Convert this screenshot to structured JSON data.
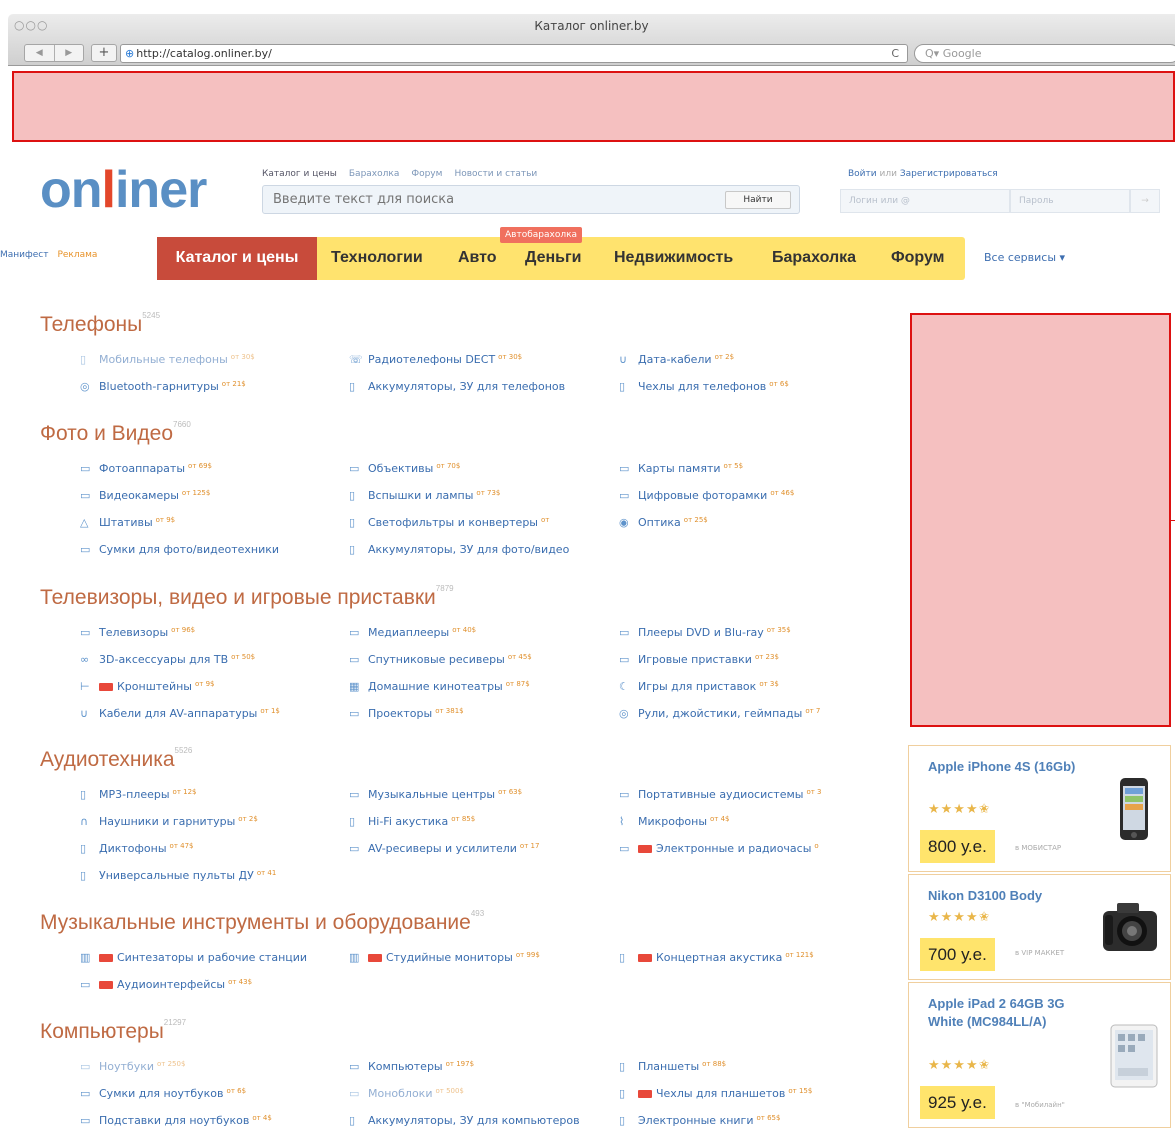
{
  "browser": {
    "window_title": "Каталог onliner.by",
    "url": "http://catalog.onliner.by/",
    "search_placeholder": "Google",
    "traffic": "○○○",
    "back": "◀",
    "forward": "▶",
    "plus": "+",
    "globe": "⊕",
    "reload": "C",
    "search_prefix": "Q▾"
  },
  "header": {
    "logo_a": "on",
    "logo_b": "l",
    "logo_c": "iner",
    "top_links": [
      "Каталог и цены",
      "Барахолка",
      "Форум",
      "Новости и статьи"
    ],
    "search_placeholder": "Введите текст для поиска",
    "find_label": "Найти",
    "login_link": "Войти",
    "or_text": "или",
    "register_link": "Зарегистрироваться",
    "login_placeholder": "Логин или @",
    "password_placeholder": "Пароль",
    "login_button": "→"
  },
  "nav": {
    "left_links": [
      "Манифест",
      "Реклама"
    ],
    "active": "Каталог и цены",
    "items": [
      "Технологии",
      "Авто",
      "Деньги",
      "Недвижимость",
      "Барахолка",
      "Форум"
    ],
    "badge": "Автобарахолка",
    "all_services": "Все сервисы ▾"
  },
  "catalog": [
    {
      "title": "Телефоны",
      "count": "5245",
      "items": [
        {
          "icon": "▯",
          "label": "Мобильные телефоны",
          "price": "от 30$"
        },
        {
          "icon": "☏",
          "label": "Радиотелефоны DECT",
          "price": "от 30$"
        },
        {
          "icon": "∪",
          "label": "Дата-кабели",
          "price": "от 2$"
        },
        {
          "icon": "◎",
          "label": "Bluetooth-гарнитуры",
          "price": "от 21$"
        },
        {
          "icon": "▯",
          "label": "Аккумуляторы, ЗУ для телефонов",
          "price": ""
        },
        {
          "icon": "▯",
          "label": "Чехлы для телефонов",
          "price": "от 6$"
        }
      ]
    },
    {
      "title": "Фото и Видео",
      "count": "7660",
      "items": [
        {
          "icon": "▭",
          "label": "Фотоаппараты",
          "price": "от 69$"
        },
        {
          "icon": "▭",
          "label": "Объективы",
          "price": "от 70$"
        },
        {
          "icon": "▭",
          "label": "Карты памяти",
          "price": "от 5$"
        },
        {
          "icon": "▭",
          "label": "Видеокамеры",
          "price": "от 125$"
        },
        {
          "icon": "▯",
          "label": "Вспышки и лампы",
          "price": "от 73$"
        },
        {
          "icon": "▭",
          "label": "Цифровые фоторамки",
          "price": "от 46$"
        },
        {
          "icon": "△",
          "label": "Штативы",
          "price": "от 9$"
        },
        {
          "icon": "▯",
          "label": "Светофильтры и конвертеры",
          "price": "от"
        },
        {
          "icon": "◉",
          "label": "Оптика",
          "price": "от 25$"
        },
        {
          "icon": "▭",
          "label": "Сумки для фото/видеотехники",
          "price": ""
        },
        {
          "icon": "▯",
          "label": "Аккумуляторы, ЗУ для фото/видео",
          "price": ""
        }
      ]
    },
    {
      "title": "Телевизоры, видео и игровые приставки",
      "count": "7879",
      "items": [
        {
          "icon": "▭",
          "label": "Телевизоры",
          "price": "от 96$"
        },
        {
          "icon": "▭",
          "label": "Медиаплееры",
          "price": "от 40$"
        },
        {
          "icon": "▭",
          "label": "Плееры DVD и Blu-ray",
          "price": "от 35$"
        },
        {
          "icon": "∞",
          "label": "3D-аксессуары для ТВ",
          "price": "от 50$"
        },
        {
          "icon": "▭",
          "label": "Спутниковые ресиверы",
          "price": "от 45$"
        },
        {
          "icon": "▭",
          "label": "Игровые приставки",
          "price": "от 23$"
        },
        {
          "icon": "⊢",
          "label": "Кронштейны",
          "price": "от 9$",
          "new": true
        },
        {
          "icon": "▦",
          "label": "Домашние кинотеатры",
          "price": "от 87$"
        },
        {
          "icon": "☾",
          "label": "Игры для приставок",
          "price": "от 3$"
        },
        {
          "icon": "∪",
          "label": "Кабели для AV-аппаратуры",
          "price": "от 1$"
        },
        {
          "icon": "▭",
          "label": "Проекторы",
          "price": "от 381$"
        },
        {
          "icon": "◎",
          "label": "Рули, джойстики, геймпады",
          "price": "от 7"
        }
      ]
    },
    {
      "title": "Аудиотехника",
      "count": "5526",
      "items": [
        {
          "icon": "▯",
          "label": "МР3-плееры",
          "price": "от 12$"
        },
        {
          "icon": "▭",
          "label": "Музыкальные центры",
          "price": "от 63$"
        },
        {
          "icon": "▭",
          "label": "Портативные аудиосистемы",
          "price": "от 3"
        },
        {
          "icon": "∩",
          "label": "Наушники и гарнитуры",
          "price": "от 2$"
        },
        {
          "icon": "▯",
          "label": "Hi-Fi акустика",
          "price": "от 85$"
        },
        {
          "icon": "⌇",
          "label": "Микрофоны",
          "price": "от 4$"
        },
        {
          "icon": "▯",
          "label": "Диктофоны",
          "price": "от 47$"
        },
        {
          "icon": "▭",
          "label": "AV-ресиверы и усилители",
          "price": "от 17"
        },
        {
          "icon": "▭",
          "label": "Электронные и радиочасы",
          "price": "о",
          "new": true
        },
        {
          "icon": "▯",
          "label": "Универсальные пульты ДУ",
          "price": "от 41"
        }
      ]
    },
    {
      "title": "Музыкальные инструменты и оборудование",
      "count": "493",
      "items": [
        {
          "icon": "▥",
          "label": "Синтезаторы и рабочие станции",
          "price": "",
          "new": true
        },
        {
          "icon": "▥",
          "label": "Студийные мониторы",
          "price": "от 99$",
          "new": true
        },
        {
          "icon": "▯",
          "label": "Концертная акустика",
          "price": "от 121$",
          "new": true
        },
        {
          "icon": "▭",
          "label": "Аудиоинтерфейсы",
          "price": "от 43$",
          "new": true
        }
      ]
    },
    {
      "title": "Компьютеры",
      "count": "21297",
      "items": [
        {
          "icon": "▭",
          "label": "Ноутбуки",
          "price": "от 250$"
        },
        {
          "icon": "▭",
          "label": "Компьютеры",
          "price": "от 197$"
        },
        {
          "icon": "▯",
          "label": "Планшеты",
          "price": "от 88$"
        },
        {
          "icon": "▭",
          "label": "Сумки для ноутбуков",
          "price": "от 6$"
        },
        {
          "icon": "▭",
          "label": "Моноблоки",
          "price": "от 500$"
        },
        {
          "icon": "▯",
          "label": "Чехлы для планшетов",
          "price": "от 15$",
          "new": true
        },
        {
          "icon": "▭",
          "label": "Подставки для ноутбуков",
          "price": "от 4$"
        },
        {
          "icon": "▯",
          "label": "Аккумуляторы, ЗУ для компьютеров",
          "price": ""
        },
        {
          "icon": "▯",
          "label": "Электронные книги",
          "price": "от 65$"
        }
      ]
    }
  ],
  "products": [
    {
      "name": "Apple iPhone 4S (16Gb)",
      "rating": 4.5,
      "stars": "★★★★✬",
      "price": "800 у.е.",
      "shop": "в МОБИСТАР",
      "icon": "phone-icon"
    },
    {
      "name": "Nikon D3100 Body",
      "rating": 4.5,
      "stars": "★★★★✬",
      "price": "700 у.е.",
      "shop": "в VIP МАККЕТ",
      "icon": "camera-icon"
    },
    {
      "name": "Apple iPad 2 64GB 3G White (MC984LL/A)",
      "rating": 4.5,
      "stars": "★★★★✬",
      "price": "925 у.е.",
      "shop": "в \"Мобилайн\"",
      "icon": "tablet-icon"
    }
  ],
  "colors": {
    "accent": "#c84b3b",
    "nav_yellow": "#ffe36e",
    "link": "#3a6daf",
    "ad": "#f5c0c0"
  }
}
